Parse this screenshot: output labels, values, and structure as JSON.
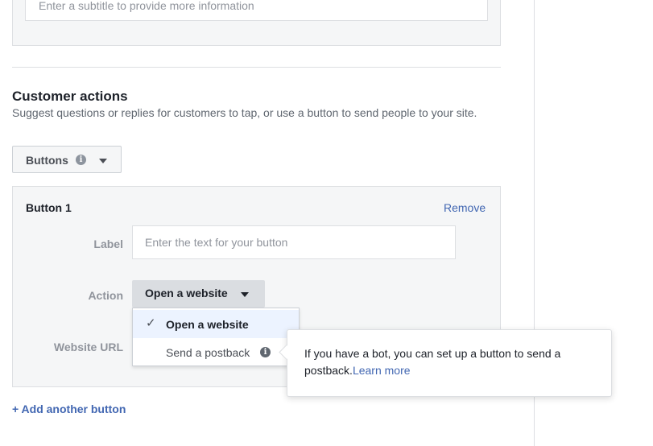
{
  "subtitle": {
    "placeholder": "Enter a subtitle to provide more information"
  },
  "customer_actions": {
    "title": "Customer actions",
    "description": "Suggest questions or replies for customers to tap, or use a button to send people to your site.",
    "type_select": {
      "value": "Buttons",
      "icons": [
        "info-icon",
        "caret-down-icon"
      ]
    }
  },
  "button_card": {
    "title": "Button 1",
    "remove_label": "Remove",
    "label_field": {
      "label": "Label",
      "placeholder": "Enter the text for your button"
    },
    "action_field": {
      "label": "Action",
      "value": "Open a website"
    },
    "url_field": {
      "label": "Website URL"
    }
  },
  "action_dropdown": {
    "options": [
      {
        "label": "Open a website",
        "selected": true,
        "icon": "checkmark-icon"
      },
      {
        "label": "Send a postback",
        "selected": false,
        "icon": "info-icon"
      }
    ]
  },
  "tooltip": {
    "text": "If you have a bot, you can set up a button to send a postback.",
    "link": "Learn more"
  },
  "add_button_label": "+ Add another button",
  "colors": {
    "link": "#4267b2",
    "selected_bg": "#ecf3ff",
    "card_bg": "#f5f6f7",
    "border": "#dddfe2"
  }
}
